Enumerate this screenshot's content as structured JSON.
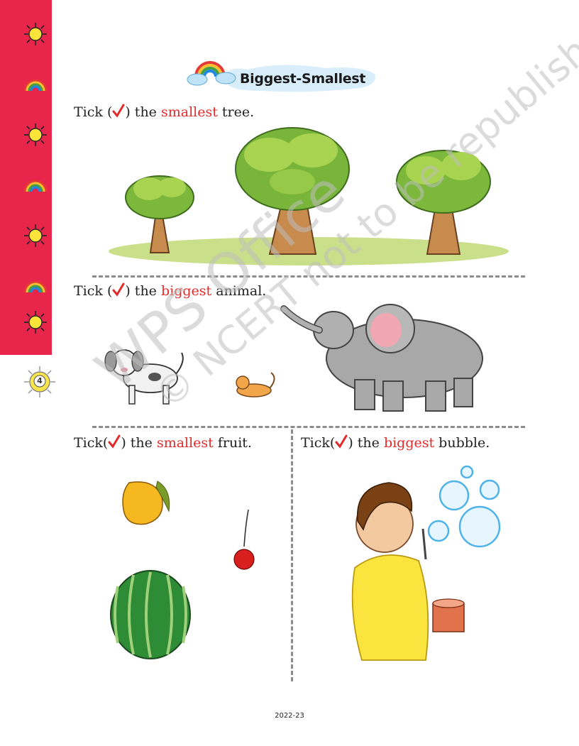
{
  "page": {
    "number": "4",
    "footer": "2022-23"
  },
  "title": "Biggest-Smallest",
  "sections": {
    "trees": {
      "pre": "Tick (",
      "post": ") the ",
      "keyword": "smallest",
      "tail": " tree."
    },
    "animals": {
      "pre": "Tick (",
      "post": ") the ",
      "keyword": "biggest",
      "tail": " animal."
    },
    "fruits": {
      "pre": "Tick(",
      "post": ") the ",
      "keyword": "smallest",
      "tail": " fruit."
    },
    "bubbles": {
      "pre": "Tick(",
      "post": ") the ",
      "keyword": "biggest",
      "tail": " bubble."
    }
  },
  "watermark": {
    "line1": "WPS Office",
    "line2": "© NCERT not to be republished"
  },
  "colors": {
    "side_band": "#e8254a",
    "keyword": "#e32a2a",
    "tick": "#e32a2a",
    "divider": "#8c8c8c"
  },
  "icons": [
    "sun-icon",
    "rainbow-icon",
    "sun-icon",
    "rainbow-icon",
    "sun-icon",
    "rainbow-icon",
    "sun-icon"
  ]
}
